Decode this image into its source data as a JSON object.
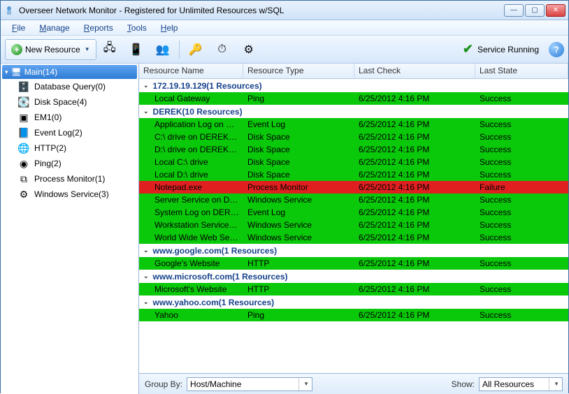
{
  "window": {
    "title": "Overseer Network Monitor - Registered for Unlimited Resources w/SQL"
  },
  "menu": {
    "file": "File",
    "manage": "Manage",
    "reports": "Reports",
    "tools": "Tools",
    "help": "Help"
  },
  "toolbar": {
    "new_resource": "New Resource",
    "service_running": "Service Running"
  },
  "sidebar": {
    "root": "Main(14)",
    "items": [
      {
        "label": "Database Query(0)",
        "icon": "🗄️"
      },
      {
        "label": "Disk Space(4)",
        "icon": "💽"
      },
      {
        "label": "EM1(0)",
        "icon": "▣"
      },
      {
        "label": "Event Log(2)",
        "icon": "📘"
      },
      {
        "label": "HTTP(2)",
        "icon": "🌐"
      },
      {
        "label": "Ping(2)",
        "icon": "◉"
      },
      {
        "label": "Process Monitor(1)",
        "icon": "⧉"
      },
      {
        "label": "Windows Service(3)",
        "icon": "⚙"
      }
    ]
  },
  "columns": {
    "name": "Resource Name",
    "type": "Resource Type",
    "check": "Last Check",
    "state": "Last State"
  },
  "groups": [
    {
      "header": "172.19.19.129(1 Resources)",
      "rows": [
        {
          "name": "Local Gateway",
          "type": "Ping",
          "check": "6/25/2012 4:16 PM",
          "state": "Success",
          "status": "success"
        }
      ]
    },
    {
      "header": "DEREK(10 Resources)",
      "rows": [
        {
          "name": "Application Log on DEREK",
          "type": "Event Log",
          "check": "6/25/2012 4:16 PM",
          "state": "Success",
          "status": "success"
        },
        {
          "name": "C:\\ drive on DEREK via ...",
          "type": "Disk Space",
          "check": "6/25/2012 4:16 PM",
          "state": "Success",
          "status": "success"
        },
        {
          "name": "D:\\ drive on DEREK via ...",
          "type": "Disk Space",
          "check": "6/25/2012 4:16 PM",
          "state": "Success",
          "status": "success"
        },
        {
          "name": "Local C:\\ drive",
          "type": "Disk Space",
          "check": "6/25/2012 4:16 PM",
          "state": "Success",
          "status": "success"
        },
        {
          "name": "Local D:\\ drive",
          "type": "Disk Space",
          "check": "6/25/2012 4:16 PM",
          "state": "Success",
          "status": "success"
        },
        {
          "name": "Notepad.exe",
          "type": "Process Monitor",
          "check": "6/25/2012 4:16 PM",
          "state": "Failure",
          "status": "failure"
        },
        {
          "name": "Server Service on DEREK",
          "type": "Windows Service",
          "check": "6/25/2012 4:16 PM",
          "state": "Success",
          "status": "success"
        },
        {
          "name": "System Log on DEREK",
          "type": "Event Log",
          "check": "6/25/2012 4:16 PM",
          "state": "Success",
          "status": "success"
        },
        {
          "name": "Workstation Service on...",
          "type": "Windows Service",
          "check": "6/25/2012 4:16 PM",
          "state": "Success",
          "status": "success"
        },
        {
          "name": "World Wide Web Servic...",
          "type": "Windows Service",
          "check": "6/25/2012 4:16 PM",
          "state": "Success",
          "status": "success"
        }
      ]
    },
    {
      "header": "www.google.com(1 Resources)",
      "rows": [
        {
          "name": "Google's Website",
          "type": "HTTP",
          "check": "6/25/2012 4:16 PM",
          "state": "Success",
          "status": "success"
        }
      ]
    },
    {
      "header": "www.microsoft.com(1 Resources)",
      "rows": [
        {
          "name": "Microsoft's Website",
          "type": "HTTP",
          "check": "6/25/2012 4:16 PM",
          "state": "Success",
          "status": "success"
        }
      ]
    },
    {
      "header": "www.yahoo.com(1 Resources)",
      "rows": [
        {
          "name": "Yahoo",
          "type": "Ping",
          "check": "6/25/2012 4:16 PM",
          "state": "Success",
          "status": "success"
        }
      ]
    }
  ],
  "footer": {
    "group_by_label": "Group By:",
    "group_by_value": "Host/Machine",
    "show_label": "Show:",
    "show_value": "All Resources"
  }
}
